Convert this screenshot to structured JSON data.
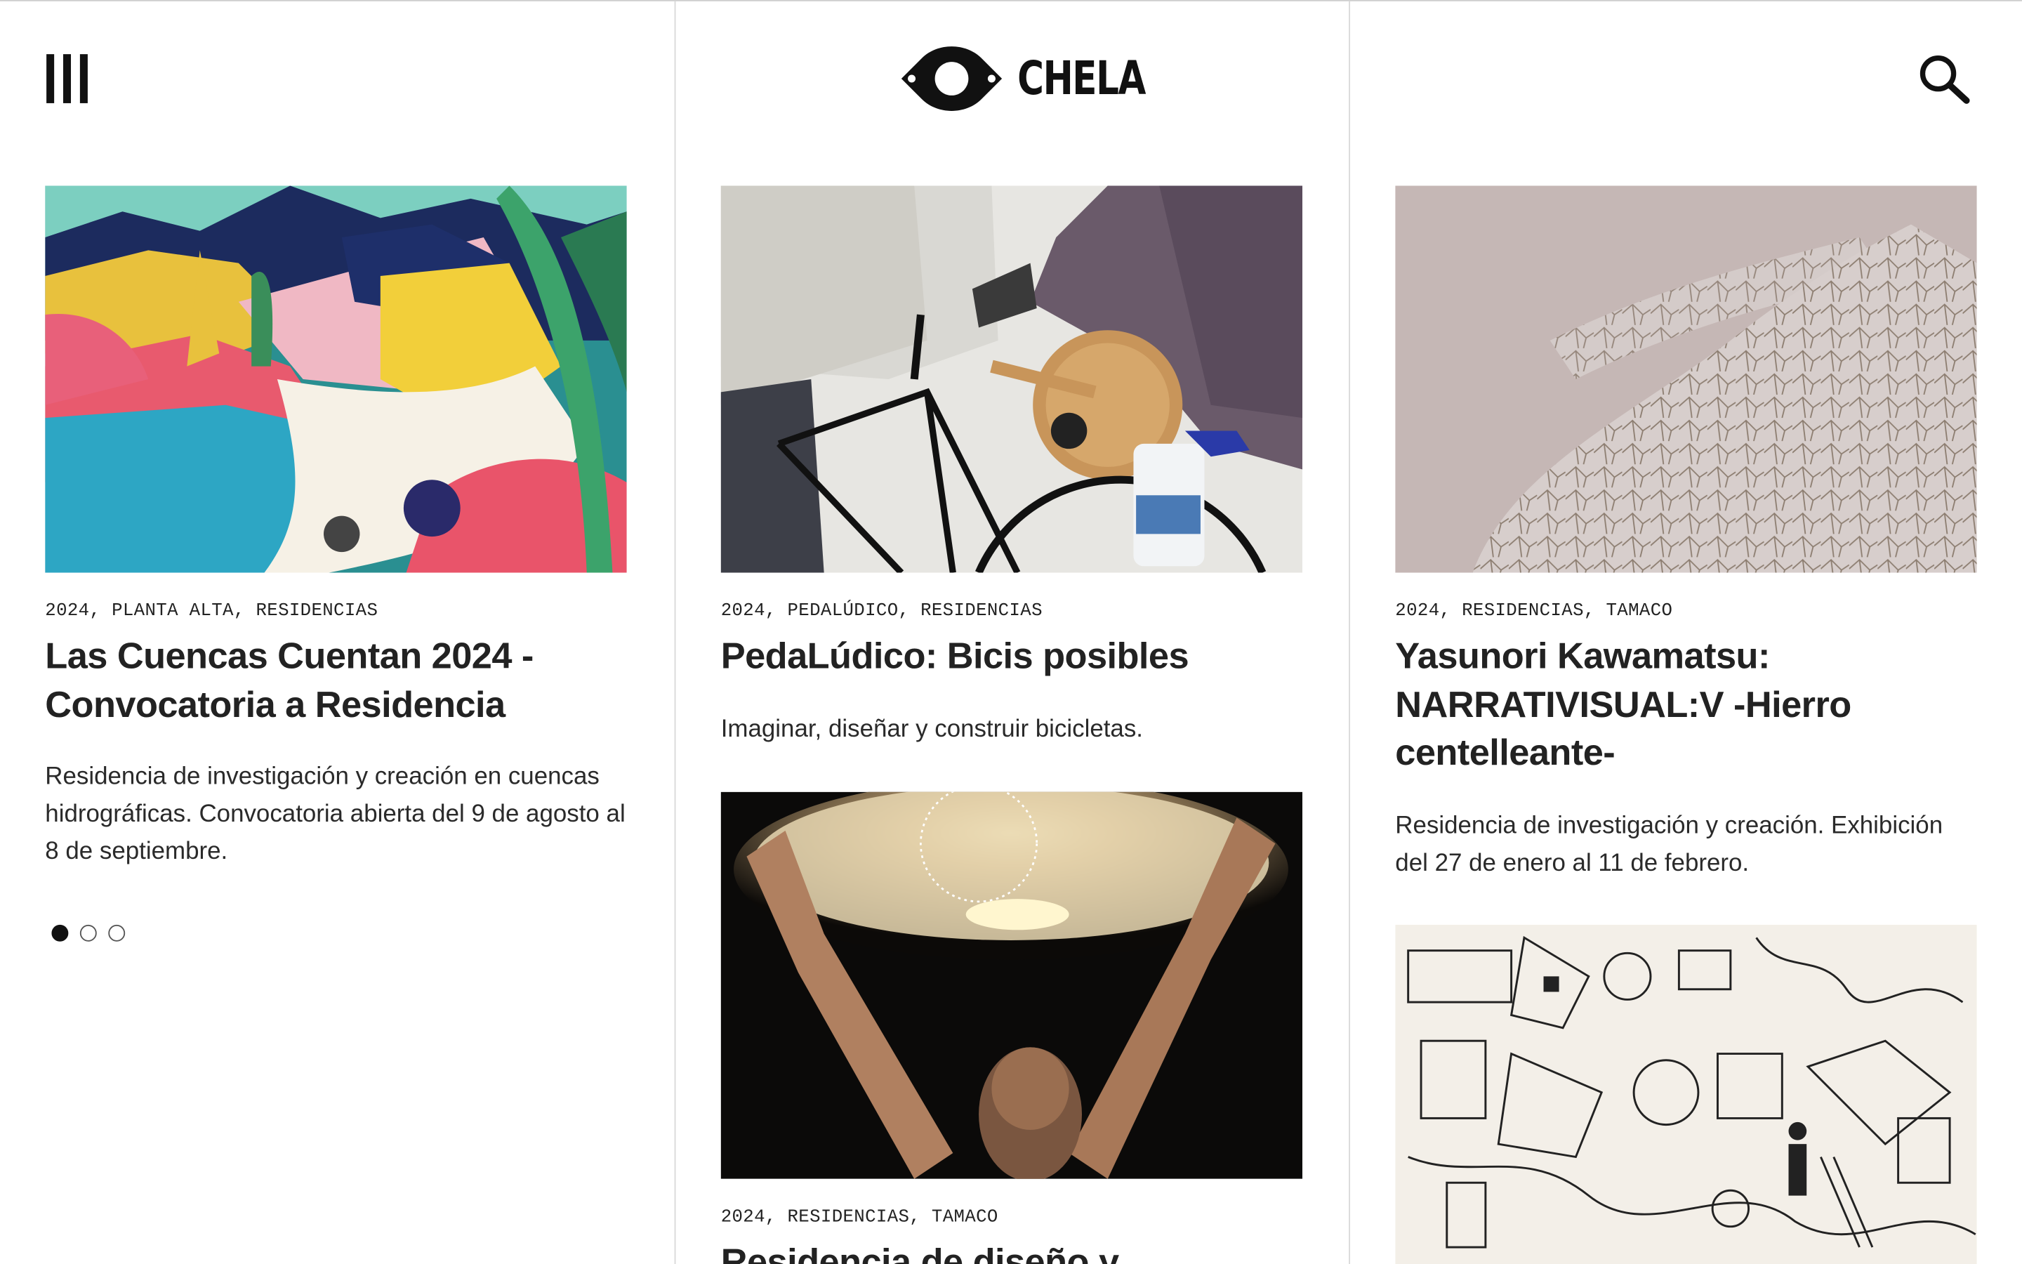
{
  "header": {
    "logo_text": "CHELA",
    "menu_icon": "menu-icon",
    "search_icon": "search-icon"
  },
  "cards": [
    {
      "tags": [
        "2024",
        "PLANTA ALTA",
        "RESIDENCIAS"
      ],
      "title": "Las Cuencas Cuentan 2024 - Convocatoria a Residencia",
      "description": "Residencia de investigación y creación en cuencas hidrográficas. Convocatoria abierta del 9 de agosto al 8 de septiembre."
    },
    {
      "tags": [
        "2024",
        "PEDALÚDICO",
        "RESIDENCIAS"
      ],
      "title": "PedaLúdico: Bicis posibles",
      "description": "Imaginar, diseñar y construir bicicletas."
    },
    {
      "tags": [
        "2024",
        "RESIDENCIAS",
        "TAMACO"
      ],
      "title": "Yasunori Kawamatsu: NARRATIVISUAL:V -Hierro centelleante-",
      "description": "Residencia de investigación y creación. Exhibición del 27 de enero al 11 de febrero."
    },
    {
      "tags": [
        "2024",
        "RESIDENCIAS",
        "TAMACO"
      ],
      "title": "Residencia de diseño y"
    }
  ],
  "carousel": {
    "total": 3,
    "active_index": 0
  }
}
